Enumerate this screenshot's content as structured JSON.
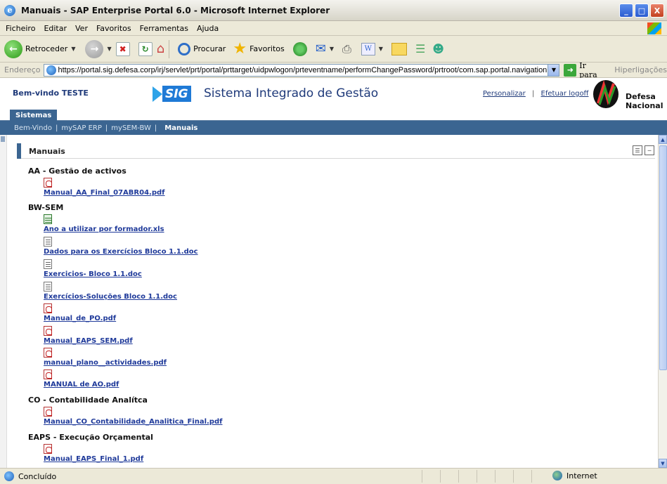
{
  "window": {
    "title": "Manuais - SAP Enterprise Portal 6.0 - Microsoft Internet Explorer",
    "buttons": [
      "_",
      "□",
      "X"
    ]
  },
  "menu": [
    "Ficheiro",
    "Editar",
    "Ver",
    "Favoritos",
    "Ferramentas",
    "Ajuda"
  ],
  "toolbar": {
    "back_label": "Retroceder",
    "search_label": "Procurar",
    "favorites_label": "Favoritos"
  },
  "address": {
    "label": "Endereço",
    "url": "https://portal.sig.defesa.corp/irj/servlet/prt/portal/prttarget/uidpwlogon/prteventname/performChangePassword/prtroot/com.sap.portal.navigation.portallaur",
    "go_label": "Ir para",
    "links_label": "Hiperligações"
  },
  "portal": {
    "welcome": "Bem-vindo TESTE",
    "logo_text": "SIG",
    "system_title": "Sistema Integrado de Gestão",
    "personalize": "Personalizar",
    "logoff": "Efetuar logoff",
    "org_line1": "Defesa",
    "org_line2": "Nacional",
    "tab": "Sistemas",
    "nav": [
      "Bem-Vindo",
      "mySAP ERP",
      "mySEM-BW",
      "Manuais"
    ],
    "iview_title": "Manuais"
  },
  "sections": [
    {
      "title": "AA - Gestão de activos",
      "files": [
        {
          "type": "pdf",
          "name": "Manual_AA_Final_07ABR04.pdf"
        }
      ]
    },
    {
      "title": "BW-SEM",
      "files": [
        {
          "type": "xls",
          "name": "Ano a utilizar por formador.xls"
        },
        {
          "type": "doc",
          "name": "Dados para os Exercícios Bloco 1.1.doc"
        },
        {
          "type": "doc",
          "name": "Exercicios- Bloco 1.1.doc"
        },
        {
          "type": "doc",
          "name": "Exercícios-Soluções Bloco 1.1.doc"
        },
        {
          "type": "pdf",
          "name": "Manual_de_PO.pdf"
        },
        {
          "type": "pdf",
          "name": "Manual_EAPS_SEM.pdf"
        },
        {
          "type": "pdf",
          "name": "manual_plano__actividades.pdf"
        },
        {
          "type": "pdf",
          "name": "MANUAL de AO.pdf"
        }
      ]
    },
    {
      "title": "CO - Contabilidade Analítca",
      "files": [
        {
          "type": "pdf",
          "name": "Manual_CO_Contabilidade_Analitica_Final.pdf"
        }
      ]
    },
    {
      "title": "EAPS - Execução Orçamental",
      "files": [
        {
          "type": "pdf",
          "name": "Manual_EAPS_Final_1.pdf"
        }
      ]
    }
  ],
  "status": {
    "text": "Concluído",
    "zone": "Internet"
  }
}
